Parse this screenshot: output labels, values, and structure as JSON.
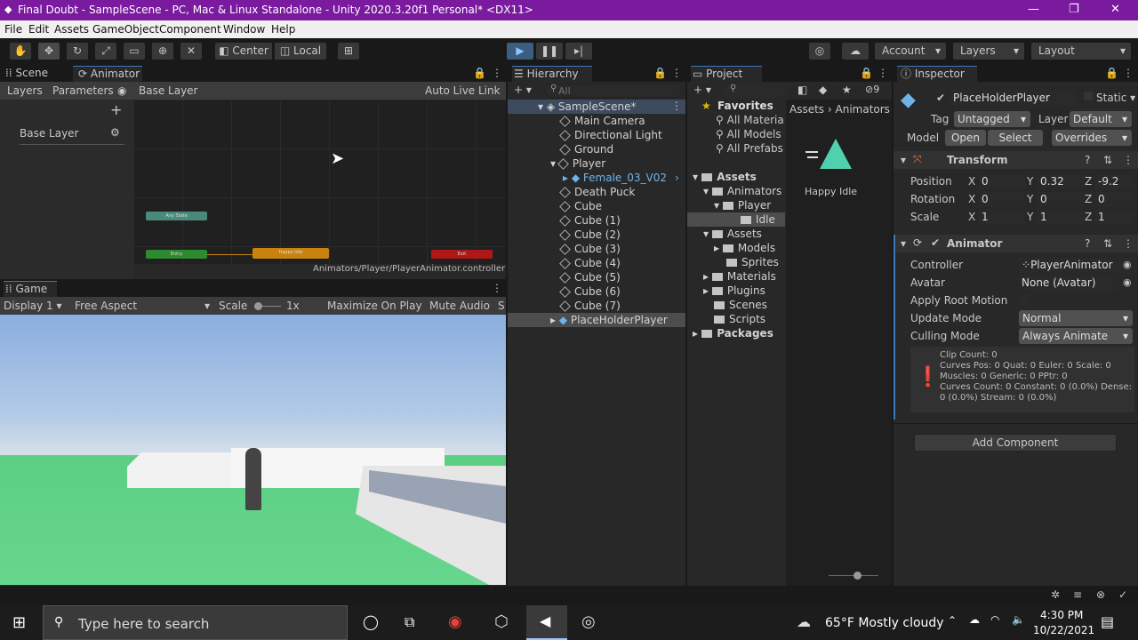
{
  "window": {
    "title": "Final Doubt - SampleScene - PC, Mac & Linux Standalone - Unity 2020.3.20f1 Personal* <DX11>"
  },
  "menu": [
    "File",
    "Edit",
    "Assets",
    "GameObject",
    "Component",
    "Window",
    "Help"
  ],
  "toolbar": {
    "pivot": "Center",
    "space": "Local",
    "account": "Account",
    "layers": "Layers",
    "layout": "Layout"
  },
  "scene_tabs": {
    "scene": "Scene",
    "animator": "Animator"
  },
  "animator": {
    "layers_tab": "Layers",
    "parameters_tab": "Parameters",
    "breadcrumb": "Base Layer",
    "auto_live": "Auto Live Link",
    "layer_name": "Base Layer",
    "path": "Animators/Player/PlayerAnimator.controller",
    "nodes": {
      "any": "Any State",
      "entry": "Entry",
      "happy": "Happy Idle",
      "exit": "Exit"
    }
  },
  "game": {
    "tab": "Game",
    "display": "Display 1",
    "aspect": "Free Aspect",
    "scale_label": "Scale",
    "scale_val": "1x",
    "maximize": "Maximize On Play",
    "mute": "Mute Audio",
    "stats": "S"
  },
  "hierarchy": {
    "tab": "Hierarchy",
    "search_placeholder": "All",
    "scene": "SampleScene*",
    "items": [
      "Main Camera",
      "Directional Light",
      "Ground",
      "Player",
      "Female_03_V02",
      "Death Puck",
      "Cube",
      "Cube (1)",
      "Cube (2)",
      "Cube (3)",
      "Cube (4)",
      "Cube (5)",
      "Cube (6)",
      "Cube (7)",
      "PlaceHolderPlayer"
    ]
  },
  "project": {
    "tab": "Project",
    "badge": "9",
    "favorites": "Favorites",
    "fav_items": [
      "All Materia",
      "All Models",
      "All Prefabs"
    ],
    "assets_root": "Assets",
    "tree": [
      "Animators",
      "Player",
      "Idle",
      "Assets",
      "Models",
      "Sprites",
      "Materials",
      "Plugins",
      "Scenes",
      "Scripts"
    ],
    "packages": "Packages",
    "breadcrumb": [
      "Assets",
      "Animators"
    ],
    "asset_label": "Happy Idle"
  },
  "inspector": {
    "tab": "Inspector",
    "object": "PlaceHolderPlayer",
    "static": "Static",
    "tag_label": "Tag",
    "tag": "Untagged",
    "layer_label": "Layer",
    "layer": "Default",
    "model_label": "Model",
    "open": "Open",
    "select": "Select",
    "overrides": "Overrides",
    "transform": "Transform",
    "position_label": "Position",
    "rotation_label": "Rotation",
    "scale_label": "Scale",
    "position": {
      "x": "0",
      "y": "0.32",
      "z": "-9.2"
    },
    "rotation": {
      "x": "0",
      "y": "0",
      "z": "0"
    },
    "scale": {
      "x": "1",
      "y": "1",
      "z": "1"
    },
    "axes": {
      "x": "X",
      "y": "Y",
      "z": "Z"
    },
    "animator": "Animator",
    "controller_label": "Controller",
    "controller": "PlayerAnimator",
    "avatar_label": "Avatar",
    "avatar": "None (Avatar)",
    "root_motion": "Apply Root Motion",
    "update_label": "Update Mode",
    "update": "Normal",
    "culling_label": "Culling Mode",
    "culling": "Always Animate",
    "info": [
      "Clip Count: 0",
      "Curves Pos: 0 Quat: 0 Euler: 0 Scale: 0",
      "Muscles: 0 Generic: 0 PPtr: 0",
      "Curves Count: 0 Constant: 0 (0.0%) Dense:",
      "0 (0.0%) Stream: 0 (0.0%)"
    ],
    "add_component": "Add Component"
  },
  "taskbar": {
    "search": "Type here to search",
    "weather": "65°F  Mostly cloudy",
    "time": "4:30 PM",
    "date": "10/22/2021"
  }
}
